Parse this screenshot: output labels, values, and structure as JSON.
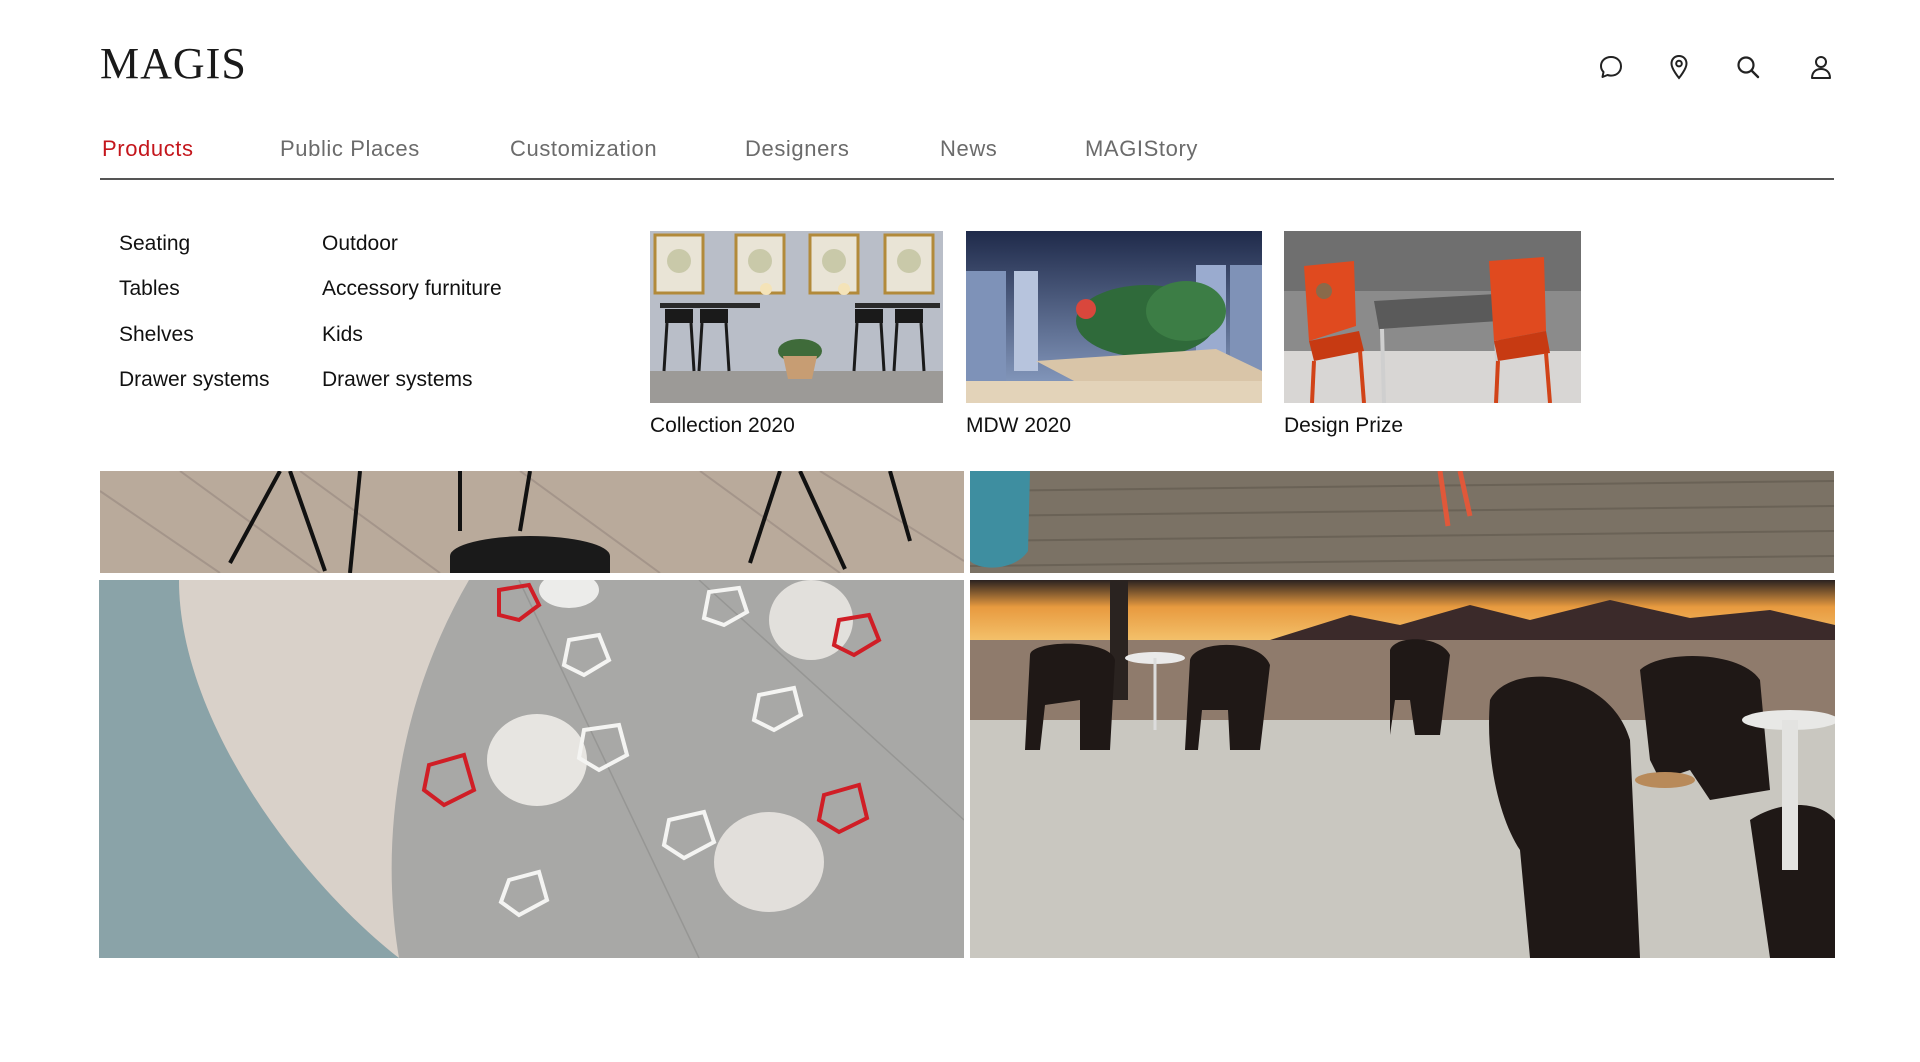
{
  "brand": {
    "logo_text": "MAGIS"
  },
  "header_icons": [
    "chat-icon",
    "location-pin-icon",
    "search-icon",
    "user-icon"
  ],
  "nav": {
    "items": [
      {
        "label": "Products",
        "active": true
      },
      {
        "label": "Public Places",
        "active": false
      },
      {
        "label": "Customization",
        "active": false
      },
      {
        "label": "Designers",
        "active": false
      },
      {
        "label": "News",
        "active": false
      },
      {
        "label": "MAGIStory",
        "active": false
      }
    ],
    "active_color": "#c4161c"
  },
  "mega_menu": {
    "column_1": [
      "Seating",
      "Tables",
      "Shelves",
      "Drawer systems"
    ],
    "column_2": [
      "Outdoor",
      "Accessory furniture",
      "Kids",
      "Drawer systems"
    ],
    "featured": [
      {
        "caption": "Collection 2020"
      },
      {
        "caption": "MDW 2020"
      },
      {
        "caption": "Design Prize"
      }
    ]
  }
}
